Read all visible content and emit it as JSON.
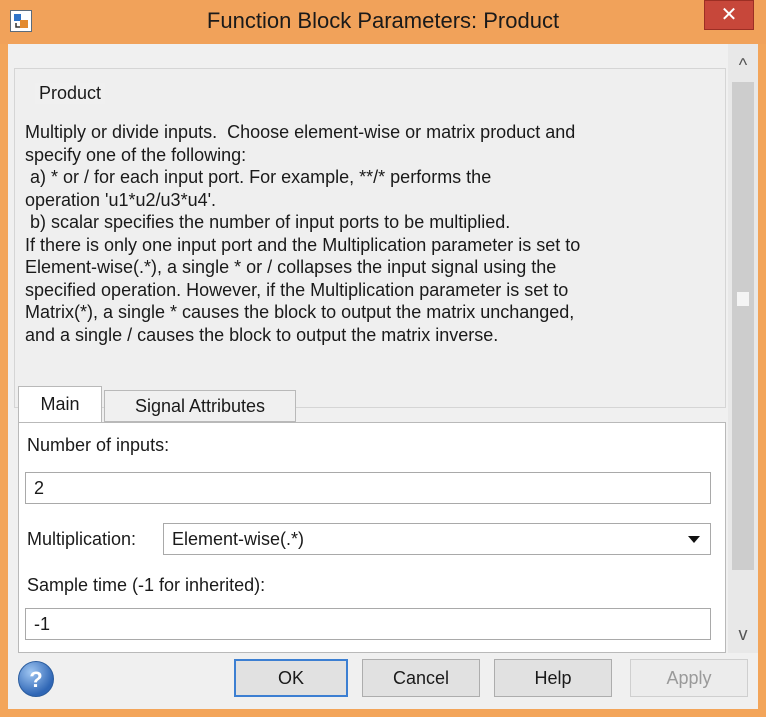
{
  "window": {
    "title": "Function Block Parameters: Product",
    "close_label": "✕"
  },
  "group": {
    "title": "Product",
    "description_lines": [
      "Multiply or divide inputs.  Choose element-wise or matrix product and",
      "specify one of the following:",
      " a) * or / for each input port. For example, **/* performs the",
      "operation 'u1*u2/u3*u4'.",
      " b) scalar specifies the number of input ports to be multiplied.",
      "If there is only one input port and the Multiplication parameter is set to",
      "Element-wise(.*), a single * or / collapses the input signal using the",
      "specified operation. However, if the Multiplication parameter is set to",
      "Matrix(*), a single * causes the block to output the matrix unchanged,",
      "and a single / causes the block to output the matrix inverse."
    ]
  },
  "tabs": [
    {
      "label": "Main",
      "selected": true
    },
    {
      "label": "Signal Attributes",
      "selected": false
    }
  ],
  "params": {
    "num_inputs_label": "Number of inputs:",
    "num_inputs_value": "2",
    "multiplication_label": "Multiplication:",
    "multiplication_value": "Element-wise(.*)",
    "sample_time_label": "Sample time (-1 for inherited):",
    "sample_time_value": "-1"
  },
  "scrollbar": {
    "up_glyph": "^",
    "down_glyph": "v"
  },
  "buttons": {
    "help_icon_glyph": "?",
    "ok": "OK",
    "cancel": "Cancel",
    "help": "Help",
    "apply": "Apply"
  },
  "colors": {
    "titlebar": "#f1a25a",
    "close": "#c7473a",
    "focus": "#3c7fd2"
  }
}
